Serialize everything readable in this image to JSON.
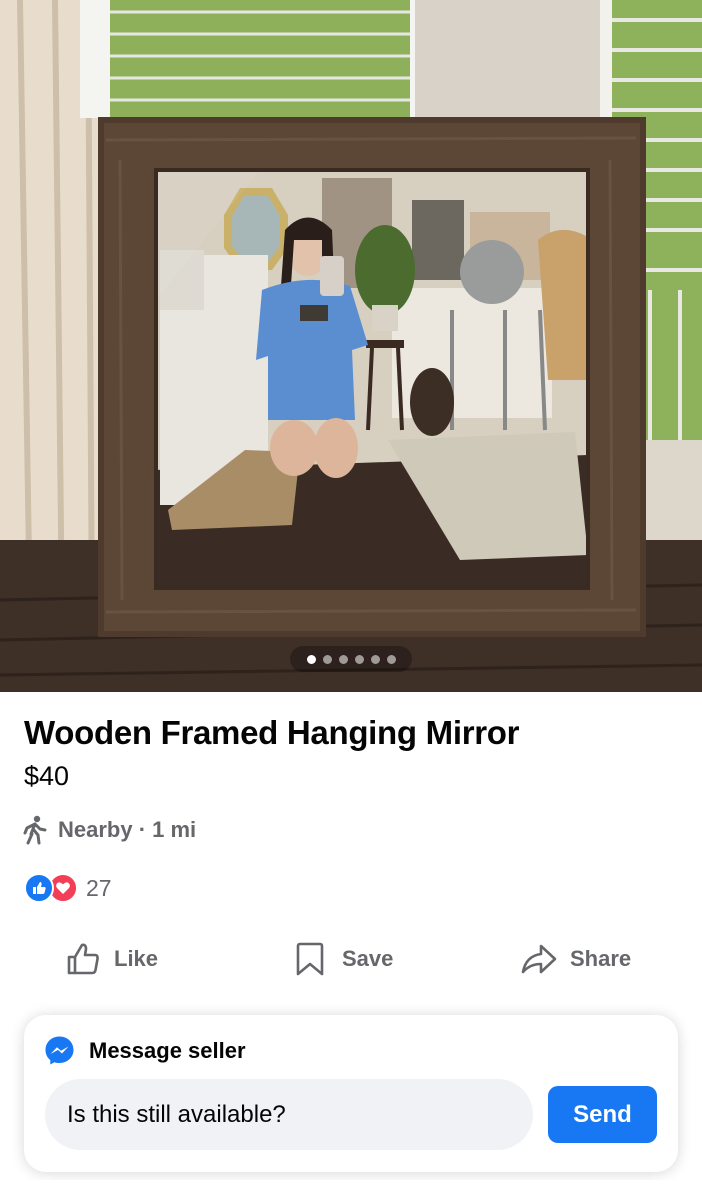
{
  "listing": {
    "title": "Wooden Framed Hanging Mirror",
    "price": "$40",
    "location": "Nearby · 1 mi",
    "reaction_count": "27"
  },
  "carousel": {
    "photo_count": 6,
    "active_index": 0
  },
  "actions": {
    "like_label": "Like",
    "save_label": "Save",
    "share_label": "Share"
  },
  "message": {
    "header": "Message seller",
    "input_value": "Is this still available?",
    "send_label": "Send"
  },
  "icons": {
    "location": "walking-person-icon",
    "reactions": [
      "like-reaction-icon",
      "love-reaction-icon"
    ],
    "like": "thumbs-up-icon",
    "save": "bookmark-icon",
    "share": "share-arrow-icon",
    "message": "messenger-icon"
  },
  "colors": {
    "accent": "#1877f2",
    "love": "#f33e58",
    "secondary_text": "#65676b",
    "input_bg": "#f0f2f5"
  }
}
